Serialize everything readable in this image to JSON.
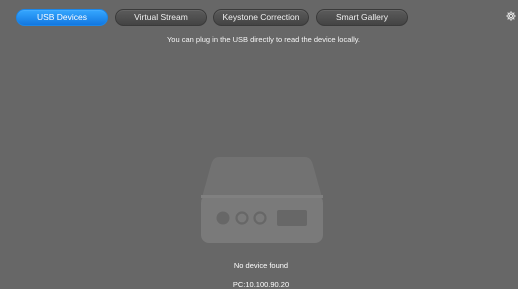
{
  "tabs": [
    {
      "label": "USB Devices",
      "active": true
    },
    {
      "label": "Virtual Stream",
      "active": false
    },
    {
      "label": "Keystone Correction",
      "active": false
    },
    {
      "label": "Smart Gallery",
      "active": false
    }
  ],
  "settings": {
    "icon": "gear-icon"
  },
  "main": {
    "hint": "You can plug in the USB directly to read the device locally.",
    "illustration_icon": "usb-device-icon",
    "status": "No device found",
    "ip": "PC:10.100.90.20"
  },
  "colors": {
    "background": "#676767",
    "accent": "#1b86e8",
    "tab_inactive": "#4a4a4a",
    "illustration": "#7a7a7a"
  }
}
